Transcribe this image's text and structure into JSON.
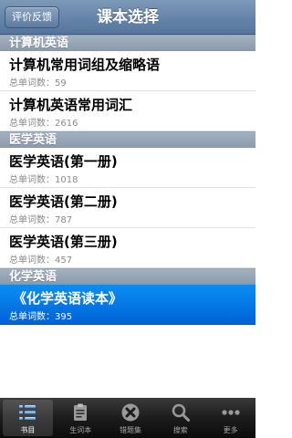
{
  "navbar": {
    "left_button": "评价反馈",
    "title": "课本选择"
  },
  "sections": [
    {
      "title": "计算机英语",
      "items": [
        {
          "title": "计算机常用词组及缩略语",
          "subtitle": "总单词数：59"
        },
        {
          "title": "计算机英语常用词汇",
          "subtitle": "总单词数：2616"
        }
      ]
    },
    {
      "title": "医学英语",
      "items": [
        {
          "title": "医学英语(第一册)",
          "subtitle": "总单词数：1018"
        },
        {
          "title": "医学英语(第二册)",
          "subtitle": "总单词数：787"
        },
        {
          "title": "医学英语(第三册)",
          "subtitle": "总单词数：457"
        }
      ]
    },
    {
      "title": "化学英语",
      "items": [
        {
          "title": "《化学英语读本》",
          "subtitle": "总单词数：395",
          "selected": true
        }
      ]
    }
  ],
  "tabbar": {
    "items": [
      {
        "label": "书目",
        "icon": "list-icon",
        "active": true
      },
      {
        "label": "生词本",
        "icon": "clipboard-icon"
      },
      {
        "label": "错题集",
        "icon": "close-circle-icon"
      },
      {
        "label": "搜索",
        "icon": "search-icon"
      },
      {
        "label": "更多",
        "icon": "more-icon"
      }
    ]
  },
  "colors": {
    "navbar": "#6786ab",
    "selection": "#0a78e6",
    "section_header": "#98a6b5",
    "tabbar": "#1c1c1c"
  }
}
